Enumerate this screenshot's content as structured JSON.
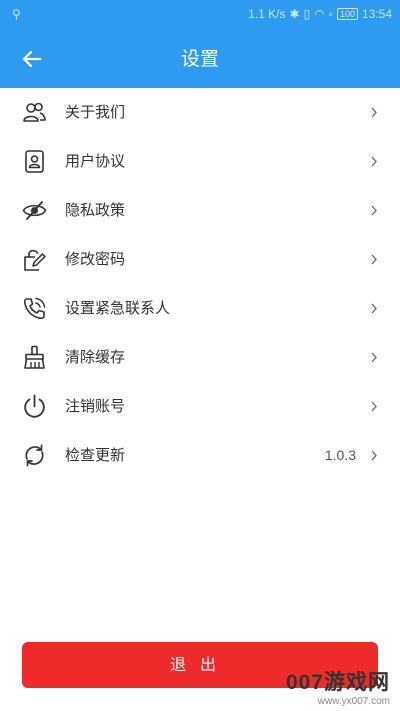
{
  "status_bar": {
    "network_speed": "1.1 K/s",
    "battery": "100",
    "time": "13:54"
  },
  "header": {
    "title": "设置",
    "back_icon": "arrow-left-icon"
  },
  "menu": [
    {
      "label": "关于我们",
      "icon": "people-icon"
    },
    {
      "label": "用户协议",
      "icon": "user-card-icon"
    },
    {
      "label": "隐私政策",
      "icon": "eye-off-icon"
    },
    {
      "label": "修改密码",
      "icon": "lock-edit-icon"
    },
    {
      "label": "设置紧急联系人",
      "icon": "phone-call-icon"
    },
    {
      "label": "清除缓存",
      "icon": "broom-icon"
    },
    {
      "label": "注销账号",
      "icon": "power-icon"
    },
    {
      "label": "检查更新",
      "icon": "refresh-icon",
      "value": "1.0.3"
    }
  ],
  "logout_label": "退出",
  "watermark": {
    "main": "007游戏网",
    "sub": "www.yx007.com"
  },
  "colors": {
    "header_bg": "#2f9bf0",
    "logout_bg": "#ee2a2a",
    "text": "#333333"
  }
}
